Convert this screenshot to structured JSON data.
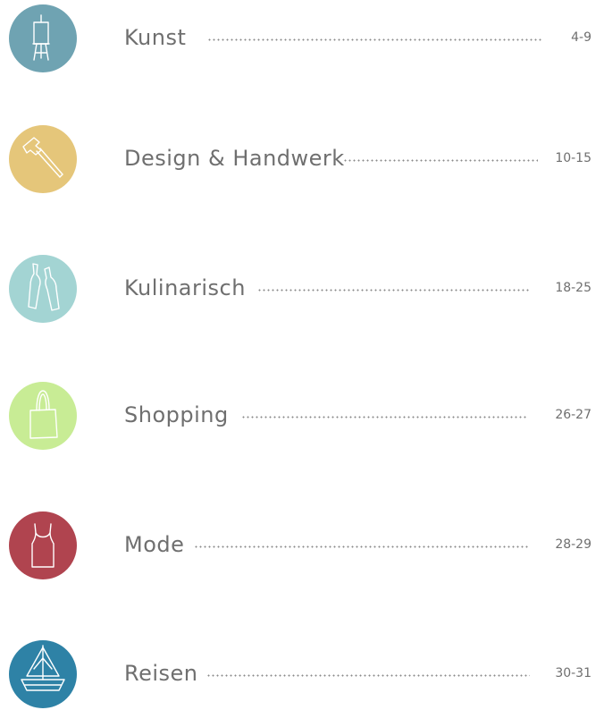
{
  "toc": {
    "items": [
      {
        "title": "Kunst",
        "pages": "4-9",
        "icon": "easel-icon",
        "color": "#6fa3b2"
      },
      {
        "title": "Design & Handwerk",
        "pages": "10-15",
        "icon": "hammer-icon",
        "color": "#e5c67a"
      },
      {
        "title": "Kulinarisch",
        "pages": "18-25",
        "icon": "bottles-icon",
        "color": "#a3d4d3"
      },
      {
        "title": "Shopping",
        "pages": "26-27",
        "icon": "shopping-bag-icon",
        "color": "#c8ec95"
      },
      {
        "title": "Mode",
        "pages": "28-29",
        "icon": "tank-top-icon",
        "color": "#b0444f"
      },
      {
        "title": "Reisen",
        "pages": "30-31",
        "icon": "sailboat-icon",
        "color": "#2e82a6"
      }
    ]
  }
}
